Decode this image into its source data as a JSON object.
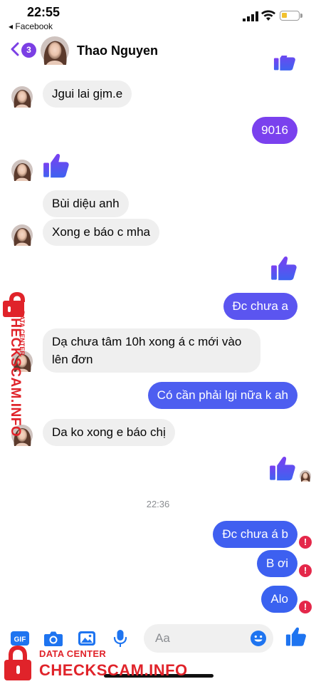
{
  "status_bar": {
    "time": "22:55",
    "back_app": "◂ Facebook"
  },
  "header": {
    "unread_count": "3",
    "contact_name": "Thao Nguyen"
  },
  "messages": [
    {
      "dir": "in",
      "text": "Jgui lai gịm.e"
    },
    {
      "dir": "out",
      "text": "9016"
    },
    {
      "dir": "in",
      "text": "Bùi diệu anh"
    },
    {
      "dir": "in",
      "text": "Xong e báo c mha"
    },
    {
      "dir": "out",
      "text": "Đc chưa a"
    },
    {
      "dir": "in",
      "text": "Dạ chưa tâm 10h xong á c mới vào lên đơn"
    },
    {
      "dir": "out",
      "text": "Có cần phải lgi nữa k ah"
    },
    {
      "dir": "in",
      "text": "Da ko xong e báo chị"
    },
    {
      "dir": "out",
      "text": "Đc chưa á b"
    },
    {
      "dir": "out",
      "text": "B ơi"
    },
    {
      "dir": "out",
      "text": "Alo"
    }
  ],
  "timestamp": "22:36",
  "alert_glyph": "!",
  "composer": {
    "placeholder": "Aa",
    "gif_label": "GIF"
  },
  "watermark": {
    "line1": "DATA CENTER",
    "line2": "CHECKSCAM.INFO"
  },
  "colors": {
    "accent": "#6b45f2",
    "bubble_in": "#efefef",
    "alert": "#e4284a",
    "watermark": "#e0232a"
  }
}
